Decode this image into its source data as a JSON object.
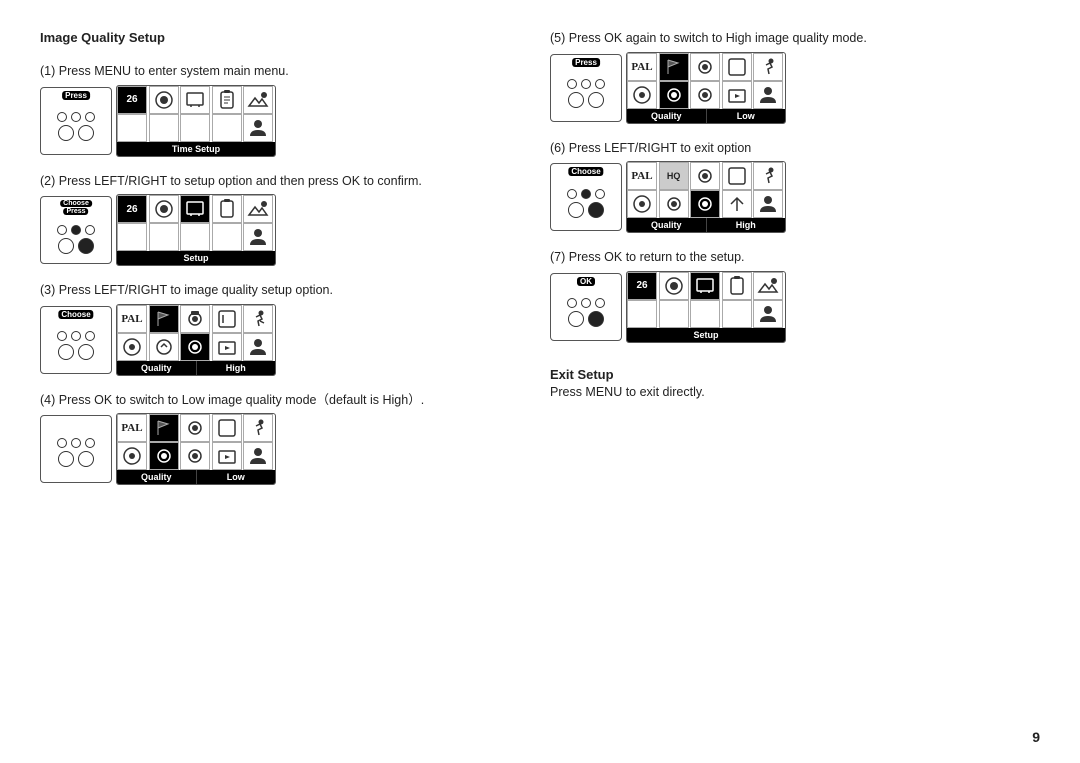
{
  "page": {
    "number": "9",
    "left_column": {
      "title": "Image Quality Setup",
      "steps": [
        {
          "number": "1",
          "text": "Press MENU to enter system main menu.",
          "remote_label": "Press",
          "menu_footer": "Time Setup",
          "menu_type": "time_setup"
        },
        {
          "number": "2",
          "text": "Press LEFT/RIGHT to setup option and then press OK to confirm.",
          "remote_label": "Choose\nPress",
          "menu_footer": "Setup",
          "menu_type": "setup"
        },
        {
          "number": "3",
          "text": "Press LEFT/RIGHT to image quality setup option.",
          "remote_label": "Choose",
          "menu_footer_left": "Quality",
          "menu_footer_right": "High",
          "menu_type": "quality_high"
        },
        {
          "number": "4",
          "text": "Press OK to switch to Low image quality mode（default is High）.",
          "menu_footer_left": "Quality",
          "menu_footer_right": "Low",
          "menu_type": "quality_low",
          "remote_label": ""
        }
      ]
    },
    "right_column": {
      "steps": [
        {
          "number": "5",
          "text": "Press OK again to switch to High image quality mode.",
          "remote_label": "Press",
          "menu_footer_left": "Quality",
          "menu_footer_right": "Low",
          "menu_type": "quality_low"
        },
        {
          "number": "6",
          "text": "Press LEFT/RIGHT to exit option",
          "remote_label": "Choose",
          "menu_footer_left": "Quality",
          "menu_footer_right": "High",
          "menu_type": "quality_high2"
        },
        {
          "number": "7",
          "text": "Press OK to return to the setup.",
          "remote_label": "OK",
          "menu_footer": "Setup",
          "menu_type": "setup2"
        }
      ],
      "exit_title": "Exit Setup",
      "exit_text": "Press MENU to exit directly."
    }
  }
}
